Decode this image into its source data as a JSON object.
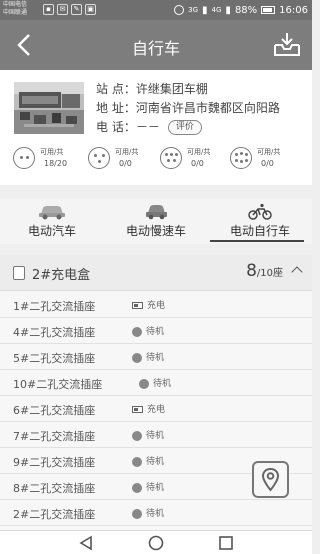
{
  "status_bar": {
    "carrier_1": "中国电信",
    "carrier_2": "中国联通",
    "signal_1": "3G",
    "signal_2": "4G",
    "battery_percent": "88%",
    "time": "16:06"
  },
  "header": {
    "title": "自行车"
  },
  "station": {
    "name_label": "站 点：",
    "name": "许继集团车棚",
    "address_label": "地 址：",
    "address": "河南省许昌市魏都区向阳路",
    "phone_label": "电 话：",
    "phone": "－－",
    "eval_button": "评价"
  },
  "availability": [
    {
      "label": "可用/共",
      "count": "18/20"
    },
    {
      "label": "可用/共",
      "count": "0/0"
    },
    {
      "label": "可用/共",
      "count": "0/0"
    },
    {
      "label": "可用/共",
      "count": "0/0"
    }
  ],
  "tabs": [
    {
      "label": "电动汽车",
      "icon": "car-icon",
      "active": false
    },
    {
      "label": "电动慢速车",
      "icon": "small-car-icon",
      "active": false
    },
    {
      "label": "电动自行车",
      "icon": "bicycle-icon",
      "active": true
    }
  ],
  "charging_box": {
    "title": "2#充电盒",
    "available": "8",
    "total": "/10座",
    "slots": [
      {
        "name": "1#二孔交流插座",
        "status": "充电",
        "state": "charging"
      },
      {
        "name": "4#二孔交流插座",
        "status": "待机",
        "state": "idle"
      },
      {
        "name": "5#二孔交流插座",
        "status": "待机",
        "state": "idle"
      },
      {
        "name": "10#二孔交流插座",
        "status": "待机",
        "state": "idle"
      },
      {
        "name": "6#二孔交流插座",
        "status": "充电",
        "state": "charging"
      },
      {
        "name": "7#二孔交流插座",
        "status": "待机",
        "state": "idle"
      },
      {
        "name": "9#二孔交流插座",
        "status": "待机",
        "state": "idle"
      },
      {
        "name": "8#二孔交流插座",
        "status": "待机",
        "state": "idle"
      },
      {
        "name": "2#二孔交流插座",
        "status": "待机",
        "state": "idle"
      }
    ]
  },
  "colors": {
    "header_bg": "#7d7d7d",
    "status_bg": "#6f6f6f",
    "text": "#333333"
  }
}
